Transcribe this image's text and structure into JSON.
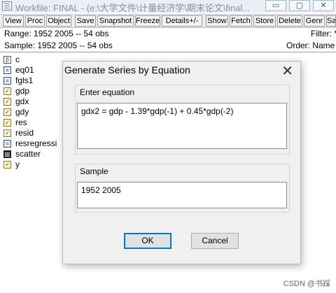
{
  "window": {
    "title": "Workfile: FINAL - (e:\\大学文件\\计量经济学\\期末论文\\final...",
    "controls": [
      "▭",
      "▢",
      "✕"
    ]
  },
  "toolbar": [
    {
      "label": "View"
    },
    {
      "label": "Proc"
    },
    {
      "label": "Object"
    },
    {
      "label": "Save"
    },
    {
      "label": "Snapshot"
    },
    {
      "label": "Freeze"
    },
    {
      "label": "Details+/-"
    },
    {
      "label": "Show"
    },
    {
      "label": "Fetch"
    },
    {
      "label": "Store"
    },
    {
      "label": "Delete"
    },
    {
      "label": "Genr"
    },
    {
      "label": "Sam"
    }
  ],
  "range_line": {
    "left": "Range:  1952 2005   --   54 obs",
    "right": "Filter: *"
  },
  "sample_line": {
    "left": "Sample: 1952 2005   --   54 obs",
    "right": "Order: Name"
  },
  "objects": [
    {
      "name": "c",
      "icon": "β"
    },
    {
      "name": "eq01",
      "icon": "="
    },
    {
      "name": "fgls1",
      "icon": "="
    },
    {
      "name": "gdp",
      "icon": "✓"
    },
    {
      "name": "gdx",
      "icon": "✓"
    },
    {
      "name": "gdy",
      "icon": "✓"
    },
    {
      "name": "res",
      "icon": "✓"
    },
    {
      "name": "resid",
      "icon": "✓"
    },
    {
      "name": "resregressi",
      "icon": "="
    },
    {
      "name": "scatter",
      "icon": "▥"
    },
    {
      "name": "y",
      "icon": "✓"
    }
  ],
  "dialog": {
    "title": "Generate Series by Equation",
    "close_icon": "✕",
    "equation_label": "Enter equation",
    "equation_value": "gdx2 = gdp - 1.39*gdp(-1) + 0.45*gdp(-2)",
    "sample_label": "Sample",
    "sample_value": "1952 2005",
    "ok_label": "OK",
    "cancel_label": "Cancel"
  },
  "watermark": "CSDN @书踩"
}
